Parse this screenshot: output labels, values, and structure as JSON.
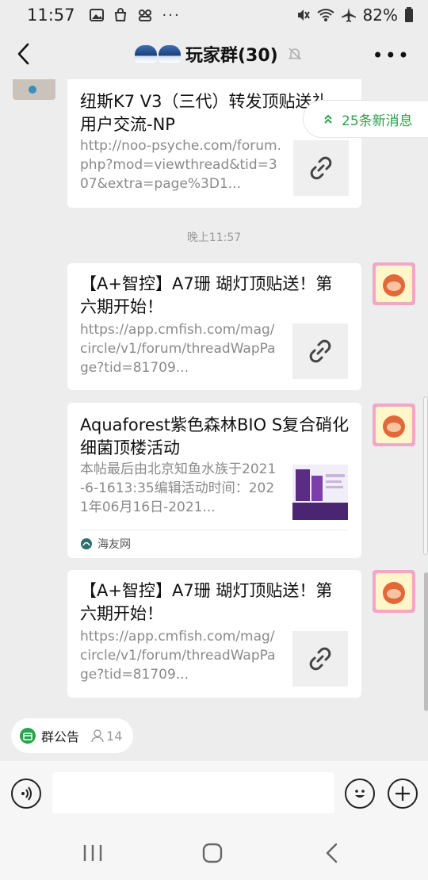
{
  "status_bar": {
    "time": "11:57",
    "battery": "82%"
  },
  "header": {
    "title": "玩家群(30)"
  },
  "new_messages": {
    "label": "25条新消息"
  },
  "messages": [
    {
      "title": "纽斯K7 V3（三代）转发顶贴送礼用户交流-NP",
      "desc": "http://noo-psyche.com/forum.php?mod=viewthread&tid=307&extra=page%3D1..."
    },
    {
      "timestamp": "晚上11:57"
    },
    {
      "title": "【A+智控】A7珊 瑚灯顶贴送！第六期开始！",
      "desc": "https://app.cmfish.com/mag/circle/v1/forum/threadWapPage?tid=81709..."
    },
    {
      "title": "Aquaforest紫色森林BIO S复合硝化细菌顶楼活动",
      "desc": "本帖最后由北京知鱼水族于2021-6-1613:35编辑活动时间：2021年06月16日-2021...",
      "source": "海友网"
    },
    {
      "title": "【A+智控】A7珊 瑚灯顶贴送！第六期开始！",
      "desc": "https://app.cmfish.com/mag/circle/v1/forum/threadWapPage?tid=81709..."
    }
  ],
  "bottom": {
    "notice_label": "群公告",
    "member_count": "14"
  },
  "colors": {
    "accent_green": "#2ba24c",
    "background": "#ededed"
  }
}
